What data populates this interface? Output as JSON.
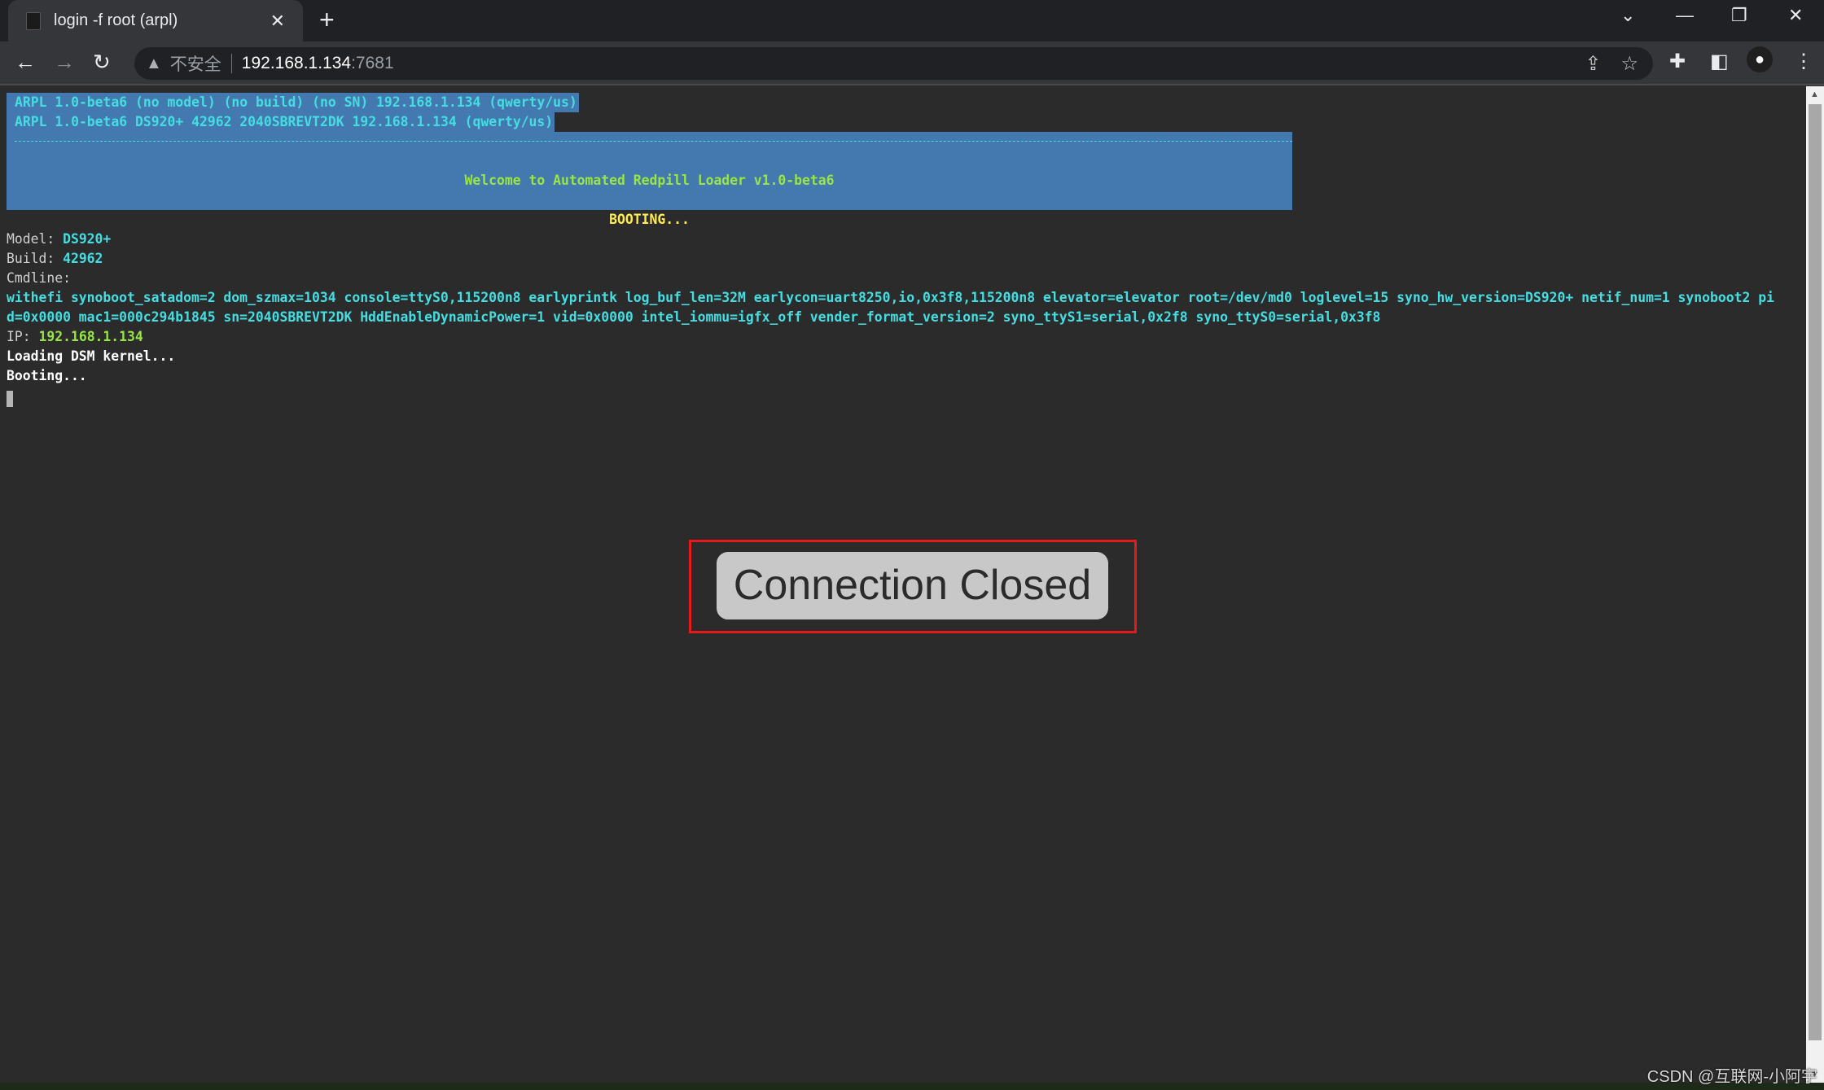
{
  "browser": {
    "tab_title": "login -f root (arpl)",
    "security_label": "不安全",
    "url_host": "192.168.1.134",
    "url_port": ":7681"
  },
  "terminal": {
    "header1": "ARPL 1.0-beta6 (no model) (no build) (no SN) 192.168.1.134 (qwerty/us)",
    "header2": "ARPL 1.0-beta6 DS920+ 42962 2040SBREVT2DK 192.168.1.134 (qwerty/us)",
    "welcome": "Welcome to Automated Redpill Loader v1.0-beta6",
    "booting_banner": "BOOTING...",
    "model_label": "Model: ",
    "model_value": "DS920+",
    "build_label": "Build: ",
    "build_value": "42962",
    "cmdline_label": "Cmdline:",
    "cmdline_1": "withefi synoboot_satadom=2 dom_szmax=1034 console=ttyS0,115200n8 earlyprintk log_buf_len=32M earlycon=uart8250,io,0x3f8,115200n8 elevator=elevator root=/dev/md0 loglevel=15 syno_hw_version=DS920+ netif_num=1 synoboot2 pi",
    "cmdline_2": "d=0x0000 mac1=000c294b1845 sn=2040SBREVT2DK HddEnableDynamicPower=1 vid=0x0000 intel_iommu=igfx_off vender_format_version=2 syno_ttyS1=serial,0x2f8 syno_ttyS0=serial,0x3f8",
    "ip_label": "IP: ",
    "ip_value": "192.168.1.134",
    "loading": "Loading DSM kernel...",
    "booting": "Booting..."
  },
  "overlay": {
    "message": "Connection Closed"
  },
  "watermark": "CSDN @互联网-小阿宇",
  "colors": {
    "background": "#2b2b2b",
    "cyan": "#45dde2",
    "green": "#98e646",
    "yellow": "#ffec4f",
    "selection": "#4479b0",
    "highlight_border": "#e8191a"
  }
}
